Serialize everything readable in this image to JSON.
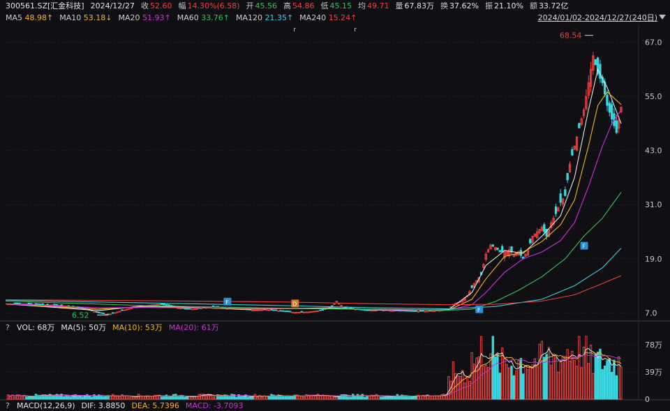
{
  "header": {
    "symbol": "300561.SZ[汇金科技]",
    "date": "2024/12/27",
    "close_label": "收",
    "close": "52.60",
    "change_label": "幅",
    "change": "14.30%(6.58)",
    "open_label": "开",
    "open": "45.56",
    "high_label": "高",
    "high": "54.86",
    "low_label": "低",
    "low": "45.15",
    "avg_label": "均",
    "avg": "49.71",
    "volume_label": "量",
    "volume": "67.83万",
    "turnover_label": "换",
    "turnover": "37.62%",
    "amplitude_label": "振",
    "amplitude": "21.10%",
    "amount_label": "额",
    "amount": "33.72亿"
  },
  "ma_bar": {
    "items": [
      {
        "name": "MA5",
        "value": "48.98↑"
      },
      {
        "name": "MA10",
        "value": "53.18↓"
      },
      {
        "name": "MA20",
        "value": "51.93↑"
      },
      {
        "name": "MA60",
        "value": "33.76↑"
      },
      {
        "name": "MA120",
        "value": "21.35↑"
      },
      {
        "name": "MA240",
        "value": "15.24↑"
      }
    ],
    "range": "2024/01/02-2024/12/27(240日)"
  },
  "volume_bar": {
    "q": "?",
    "vol": "VOL: 68万",
    "ma5": "MA(5): 50万",
    "ma10": "MA(10): 53万",
    "ma20": "MA(20): 61万"
  },
  "macd_bar": {
    "q": "?",
    "name": "MACD(12,26,9)",
    "dif": "DIF: 3.8850",
    "dea": "DEA: 5.7396",
    "macd": "MACD: -3.7093"
  },
  "colors": {
    "up": "#f0413c",
    "down": "#38d6df",
    "ma5": "#e6e6e6",
    "ma10": "#f3b52a",
    "ma20": "#d12fd8",
    "ma60": "#36c25b",
    "ma120": "#3fd0e0",
    "ma240": "#f0413c"
  },
  "chart_data": [
    {
      "type": "candlestick",
      "y_ticks": [
        7.0,
        19.0,
        31.0,
        43.0,
        55.0,
        67.0
      ],
      "ylim": [
        5.5,
        70.5
      ],
      "annotations": [
        {
          "text": "68.54",
          "value": 68.54,
          "kind": "high"
        },
        {
          "text": "6.52",
          "value": 6.52,
          "kind": "low"
        }
      ],
      "markers": [
        "F",
        "D",
        "F",
        "F"
      ],
      "small_markers": [
        "r",
        "r"
      ],
      "series_path": [
        [
          0,
          9.0
        ],
        [
          8,
          9.0
        ],
        [
          16,
          8.8
        ],
        [
          22,
          8.7
        ],
        [
          30,
          8.3
        ],
        [
          36,
          7.6
        ],
        [
          40,
          7.0
        ],
        [
          44,
          6.6
        ],
        [
          48,
          7.2
        ],
        [
          52,
          7.8
        ],
        [
          56,
          8.3
        ],
        [
          62,
          8.7
        ],
        [
          66,
          8.9
        ],
        [
          70,
          8.6
        ],
        [
          74,
          8.1
        ],
        [
          78,
          7.8
        ],
        [
          82,
          7.9
        ],
        [
          86,
          8.2
        ],
        [
          90,
          8.4
        ],
        [
          94,
          8.0
        ],
        [
          100,
          7.8
        ],
        [
          106,
          7.6
        ],
        [
          112,
          7.7
        ],
        [
          118,
          7.4
        ],
        [
          124,
          7.1
        ],
        [
          130,
          7.2
        ],
        [
          136,
          7.6
        ],
        [
          140,
          8.4
        ],
        [
          142,
          9.6
        ],
        [
          145,
          8.2
        ],
        [
          150,
          7.8
        ],
        [
          155,
          7.5
        ],
        [
          160,
          7.6
        ],
        [
          165,
          7.5
        ],
        [
          170,
          7.4
        ],
        [
          176,
          7.3
        ],
        [
          182,
          7.4
        ],
        [
          186,
          7.5
        ],
        [
          190,
          7.8
        ],
        [
          192,
          8.9
        ],
        [
          195,
          9.5
        ],
        [
          198,
          10.8
        ],
        [
          201,
          13.5
        ],
        [
          204,
          15.5
        ],
        [
          206,
          20.0
        ],
        [
          208,
          22.0
        ],
        [
          210,
          21.5
        ],
        [
          212,
          20.5
        ],
        [
          214,
          20.5
        ],
        [
          216,
          21.0
        ],
        [
          218,
          20.0
        ],
        [
          220,
          20.5
        ],
        [
          222,
          19.0
        ],
        [
          224,
          21.0
        ],
        [
          226,
          24.0
        ],
        [
          228,
          25.0
        ],
        [
          230,
          26.0
        ],
        [
          232,
          24.0
        ],
        [
          234,
          27.0
        ],
        [
          236,
          29.0
        ],
        [
          238,
          31.5
        ],
        [
          240,
          33.0
        ],
        [
          242,
          40.0
        ],
        [
          244,
          44.0
        ],
        [
          246,
          48.0
        ],
        [
          248,
          52.0
        ],
        [
          250,
          58.0
        ],
        [
          252,
          64.0
        ],
        [
          254,
          60.0
        ],
        [
          256,
          58.0
        ],
        [
          258,
          53.0
        ],
        [
          260,
          50.0
        ],
        [
          262,
          47.0
        ],
        [
          264,
          52.6
        ]
      ],
      "ma_paths": {
        "ma5": [
          [
            0,
            9.0
          ],
          [
            40,
            7.5
          ],
          [
            60,
            8.6
          ],
          [
            100,
            7.8
          ],
          [
            140,
            8.1
          ],
          [
            160,
            7.6
          ],
          [
            190,
            7.7
          ],
          [
            200,
            11.5
          ],
          [
            206,
            17.5
          ],
          [
            214,
            20.8
          ],
          [
            222,
            20.2
          ],
          [
            230,
            24.0
          ],
          [
            238,
            28.5
          ],
          [
            244,
            37.0
          ],
          [
            250,
            52.0
          ],
          [
            254,
            61.0
          ],
          [
            258,
            57.0
          ],
          [
            264,
            48.98
          ]
        ],
        "ma10": [
          [
            0,
            9.0
          ],
          [
            40,
            7.8
          ],
          [
            60,
            8.4
          ],
          [
            100,
            7.9
          ],
          [
            140,
            7.9
          ],
          [
            160,
            7.7
          ],
          [
            190,
            7.6
          ],
          [
            200,
            10.0
          ],
          [
            206,
            14.5
          ],
          [
            214,
            19.5
          ],
          [
            222,
            20.5
          ],
          [
            230,
            22.8
          ],
          [
            238,
            26.5
          ],
          [
            244,
            32.0
          ],
          [
            250,
            44.0
          ],
          [
            254,
            53.0
          ],
          [
            258,
            56.0
          ],
          [
            264,
            53.18
          ]
        ],
        "ma20": [
          [
            0,
            9.0
          ],
          [
            40,
            8.1
          ],
          [
            60,
            8.2
          ],
          [
            100,
            8.0
          ],
          [
            140,
            7.9
          ],
          [
            160,
            7.7
          ],
          [
            190,
            7.6
          ],
          [
            200,
            8.8
          ],
          [
            206,
            11.5
          ],
          [
            214,
            16.0
          ],
          [
            222,
            19.0
          ],
          [
            230,
            20.5
          ],
          [
            238,
            23.0
          ],
          [
            244,
            27.0
          ],
          [
            250,
            35.0
          ],
          [
            256,
            44.0
          ],
          [
            260,
            49.0
          ],
          [
            264,
            51.93
          ]
        ],
        "ma60": [
          [
            0,
            9.6
          ],
          [
            60,
            8.6
          ],
          [
            120,
            8.0
          ],
          [
            160,
            7.8
          ],
          [
            190,
            7.6
          ],
          [
            200,
            7.8
          ],
          [
            210,
            9.5
          ],
          [
            220,
            12.0
          ],
          [
            230,
            15.0
          ],
          [
            240,
            19.0
          ],
          [
            248,
            24.0
          ],
          [
            256,
            28.0
          ],
          [
            264,
            33.76
          ]
        ],
        "ma120": [
          [
            0,
            9.8
          ],
          [
            60,
            9.2
          ],
          [
            120,
            8.6
          ],
          [
            160,
            8.1
          ],
          [
            190,
            7.9
          ],
          [
            210,
            8.4
          ],
          [
            230,
            10.0
          ],
          [
            244,
            13.0
          ],
          [
            256,
            17.0
          ],
          [
            264,
            21.35
          ]
        ],
        "ma240": [
          [
            0,
            9.9
          ],
          [
            60,
            9.7
          ],
          [
            120,
            9.4
          ],
          [
            160,
            9.0
          ],
          [
            190,
            8.8
          ],
          [
            210,
            8.9
          ],
          [
            230,
            9.6
          ],
          [
            244,
            11.0
          ],
          [
            256,
            13.5
          ],
          [
            264,
            15.24
          ]
        ]
      }
    },
    {
      "type": "bar",
      "name": "volume",
      "y_ticks": [
        "78万",
        "39万",
        "0"
      ],
      "ylim": [
        0,
        90
      ],
      "values_by_region": [
        [
          0,
          190,
          6
        ],
        [
          190,
          200,
          45
        ],
        [
          200,
          204,
          70
        ],
        [
          204,
          210,
          85
        ],
        [
          210,
          220,
          62
        ],
        [
          220,
          230,
          66
        ],
        [
          230,
          240,
          72
        ],
        [
          240,
          250,
          84
        ],
        [
          250,
          264,
          65
        ]
      ]
    }
  ]
}
